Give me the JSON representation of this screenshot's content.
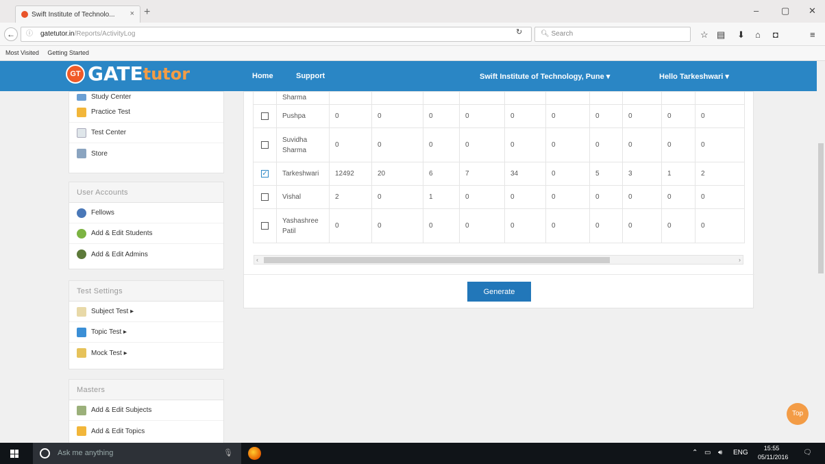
{
  "browser": {
    "tab_title": "Swift Institute of Technolo...",
    "tab_close": "×",
    "new_tab": "+",
    "url_host": "gatetutor.in",
    "url_path": "/Reports/ActivityLog",
    "search_placeholder": "Search",
    "bookmarks": [
      "Most Visited",
      "Getting Started"
    ],
    "window_controls": [
      "–",
      "▢",
      "✕"
    ]
  },
  "site": {
    "logo_gt": "GT",
    "logo_gate": "GATE",
    "logo_tutor": "tutor",
    "nav": [
      "Home",
      "Support"
    ],
    "institute": "Swift Institute of Technology, Pune ▾",
    "greeting": "Hello Tarkeshwari ▾"
  },
  "sidebar": {
    "top_items": [
      "Study Center",
      "Practice Test",
      "Test Center",
      "Store"
    ],
    "user_accounts": {
      "title": "User Accounts",
      "items": [
        "Fellows",
        "Add & Edit Students",
        "Add & Edit Admins"
      ]
    },
    "test_settings": {
      "title": "Test Settings",
      "items": [
        "Subject Test ▸",
        "Topic Test ▸",
        "Mock Test ▸"
      ]
    },
    "masters": {
      "title": "Masters",
      "items": [
        "Add & Edit Subjects",
        "Add & Edit Topics"
      ]
    }
  },
  "table": {
    "partial_name": "Sharma",
    "rows": [
      {
        "name": "Pushpa",
        "checked": false,
        "values": [
          "0",
          "0",
          "0",
          "0",
          "0",
          "0",
          "0",
          "0",
          "0",
          "0"
        ]
      },
      {
        "name": "Suvidha Sharma",
        "checked": false,
        "values": [
          "0",
          "0",
          "0",
          "0",
          "0",
          "0",
          "0",
          "0",
          "0",
          "0"
        ]
      },
      {
        "name": "Tarkeshwari",
        "checked": true,
        "values": [
          "12492",
          "20",
          "6",
          "7",
          "34",
          "0",
          "5",
          "3",
          "1",
          "2"
        ]
      },
      {
        "name": "Vishal",
        "checked": false,
        "values": [
          "2",
          "0",
          "1",
          "0",
          "0",
          "0",
          "0",
          "0",
          "0",
          "0"
        ]
      },
      {
        "name": "Yashashree Patil",
        "checked": false,
        "values": [
          "0",
          "0",
          "0",
          "0",
          "0",
          "0",
          "0",
          "0",
          "0",
          "0"
        ]
      }
    ]
  },
  "generate_label": "Generate",
  "top_button": "Top",
  "taskbar": {
    "search_placeholder": "Ask me anything",
    "lang": "ENG",
    "time": "15:55",
    "date": "05/11/2016"
  }
}
